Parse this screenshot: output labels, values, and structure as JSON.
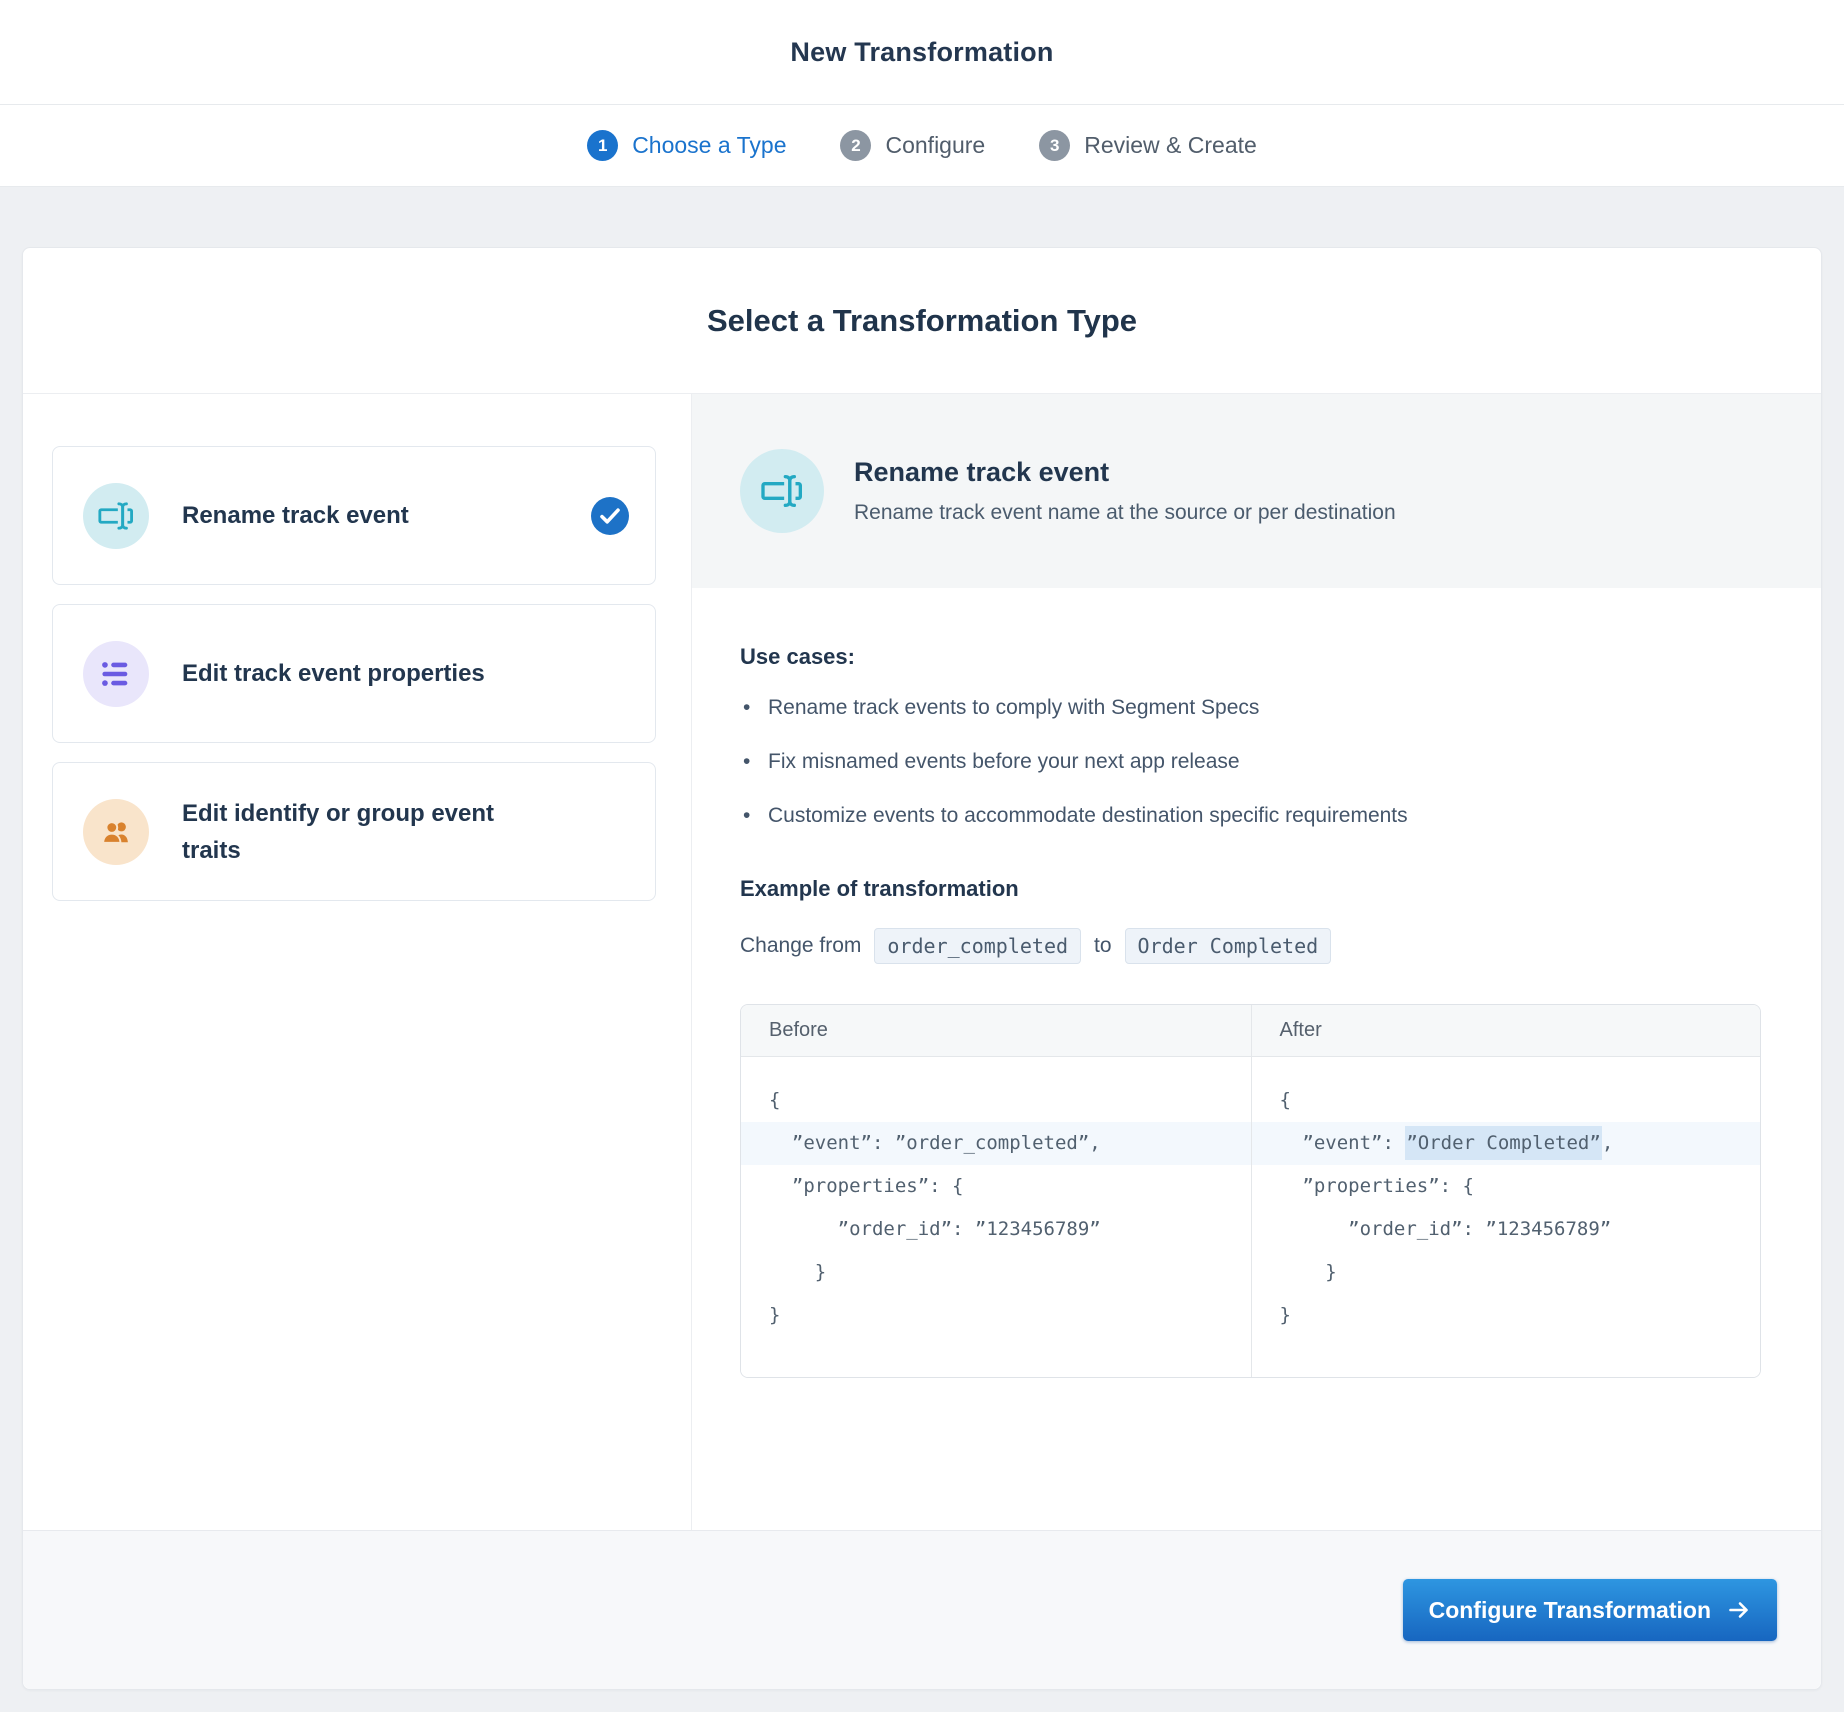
{
  "colors": {
    "accent_blue": "#1a73cd",
    "selected_check_blue": "#1d72c7",
    "teal_icon": "#23a9c3",
    "purple_icon": "#6a5be2",
    "orange_icon": "#d9822e",
    "code_highlight": "#d5e6f6"
  },
  "header": {
    "title": "New Transformation"
  },
  "stepper": {
    "steps": [
      {
        "number": "1",
        "label": "Choose a Type",
        "state": "active"
      },
      {
        "number": "2",
        "label": "Configure",
        "state": "upcoming"
      },
      {
        "number": "3",
        "label": "Review & Create",
        "state": "upcoming"
      }
    ]
  },
  "content": {
    "title": "Select a Transformation Type",
    "options": [
      {
        "label": "Rename track event",
        "icon": "rename-field-icon",
        "selected": true
      },
      {
        "label": "Edit track event properties",
        "icon": "list-icon",
        "selected": false
      },
      {
        "label": "Edit identify or group event traits",
        "icon": "users-icon",
        "selected": false
      }
    ],
    "detail": {
      "icon": "rename-field-icon",
      "title": "Rename track event",
      "description": "Rename track event name at the source or per destination",
      "use_cases_heading": "Use cases:",
      "use_cases": [
        "Rename track events to comply with Segment Specs",
        "Fix misnamed events before your next app release",
        "Customize events to accommodate destination specific requirements"
      ],
      "example_heading": "Example of transformation",
      "change": {
        "prefix": "Change from",
        "from_code": "order_completed",
        "connector": "to",
        "to_code": "Order Completed"
      },
      "code_example": {
        "before_label": "Before",
        "after_label": "After",
        "before_lines": [
          "{",
          "  ”event”: ”order_completed”,",
          "  ”properties”: {",
          "      ”order_id”: ”123456789”",
          "    }",
          "}"
        ],
        "after_open_line": "{",
        "after_event_line": {
          "pre": "  ”event”: ",
          "highlight": "”Order Completed”",
          "post": ","
        },
        "after_rest_lines": [
          "  ”properties”: {",
          "      ”order_id”: ”123456789”",
          "    }",
          "}"
        ]
      }
    }
  },
  "footer": {
    "configure_button_label": "Configure Transformation"
  }
}
